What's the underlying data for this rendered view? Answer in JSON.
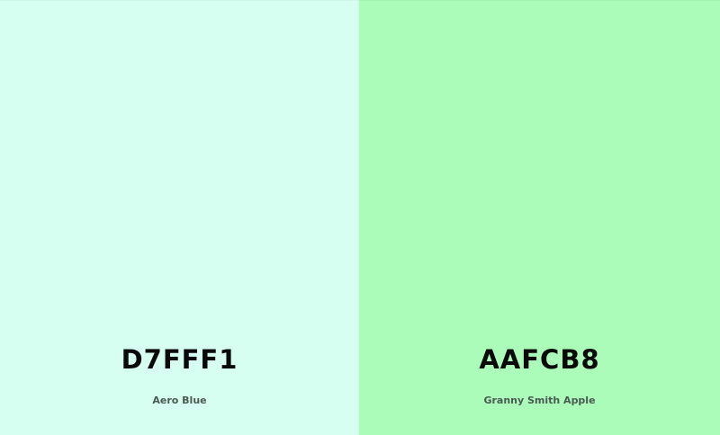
{
  "swatches": [
    {
      "hex": "D7FFF1",
      "name": "Aero Blue",
      "color": "#D7FFF1"
    },
    {
      "hex": "AAFCB8",
      "name": "Granny Smith Apple",
      "color": "#AAFCB8"
    }
  ]
}
